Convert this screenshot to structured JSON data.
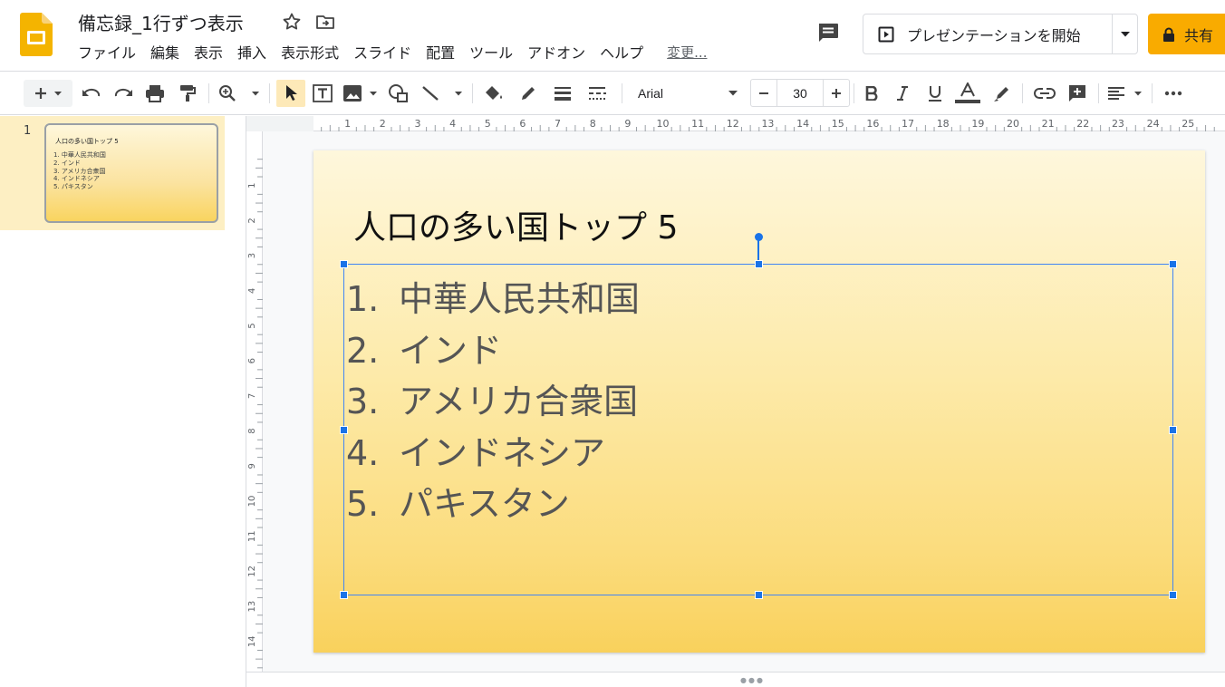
{
  "document": {
    "title": "備忘録_1行ずつ表示"
  },
  "menu": {
    "items": [
      "ファイル",
      "編集",
      "表示",
      "挿入",
      "表示形式",
      "スライド",
      "配置",
      "ツール",
      "アドオン",
      "ヘルプ"
    ],
    "changes_link": "変更..."
  },
  "header": {
    "present_label": "プレゼンテーションを開始",
    "share_label": "共有"
  },
  "toolbar": {
    "font_name": "Arial",
    "font_size": "30"
  },
  "filmstrip": {
    "slides": [
      {
        "number": "1",
        "title": "人口の多い国トップ 5",
        "items": [
          "1.  中華人民共和国",
          "2.  インド",
          "3.  アメリカ合衆国",
          "4.  インドネシア",
          "5.  パキスタン"
        ]
      }
    ]
  },
  "slide": {
    "title": "人口の多い国トップ 5",
    "list": [
      {
        "num": "1.",
        "text": "中華人民共和国"
      },
      {
        "num": "2.",
        "text": "インド"
      },
      {
        "num": "3.",
        "text": "アメリカ合衆国"
      },
      {
        "num": "4.",
        "text": "インドネシア"
      },
      {
        "num": "5.",
        "text": "パキスタン"
      }
    ]
  },
  "rulers": {
    "top_labels": [
      "1",
      "2",
      "3",
      "4",
      "5",
      "6",
      "7",
      "8",
      "9",
      "10",
      "11",
      "12",
      "13",
      "14",
      "15",
      "16",
      "17",
      "18",
      "19",
      "20",
      "21",
      "22",
      "23",
      "24",
      "25"
    ],
    "left_labels": [
      "1",
      "2",
      "3",
      "4",
      "5",
      "6",
      "7",
      "8",
      "9",
      "10",
      "11",
      "12",
      "13",
      "14"
    ]
  },
  "colors": {
    "accent_blue": "#1a73e8",
    "share_yellow": "#f9ab00",
    "filmstrip_selected": "#fdefc3"
  }
}
